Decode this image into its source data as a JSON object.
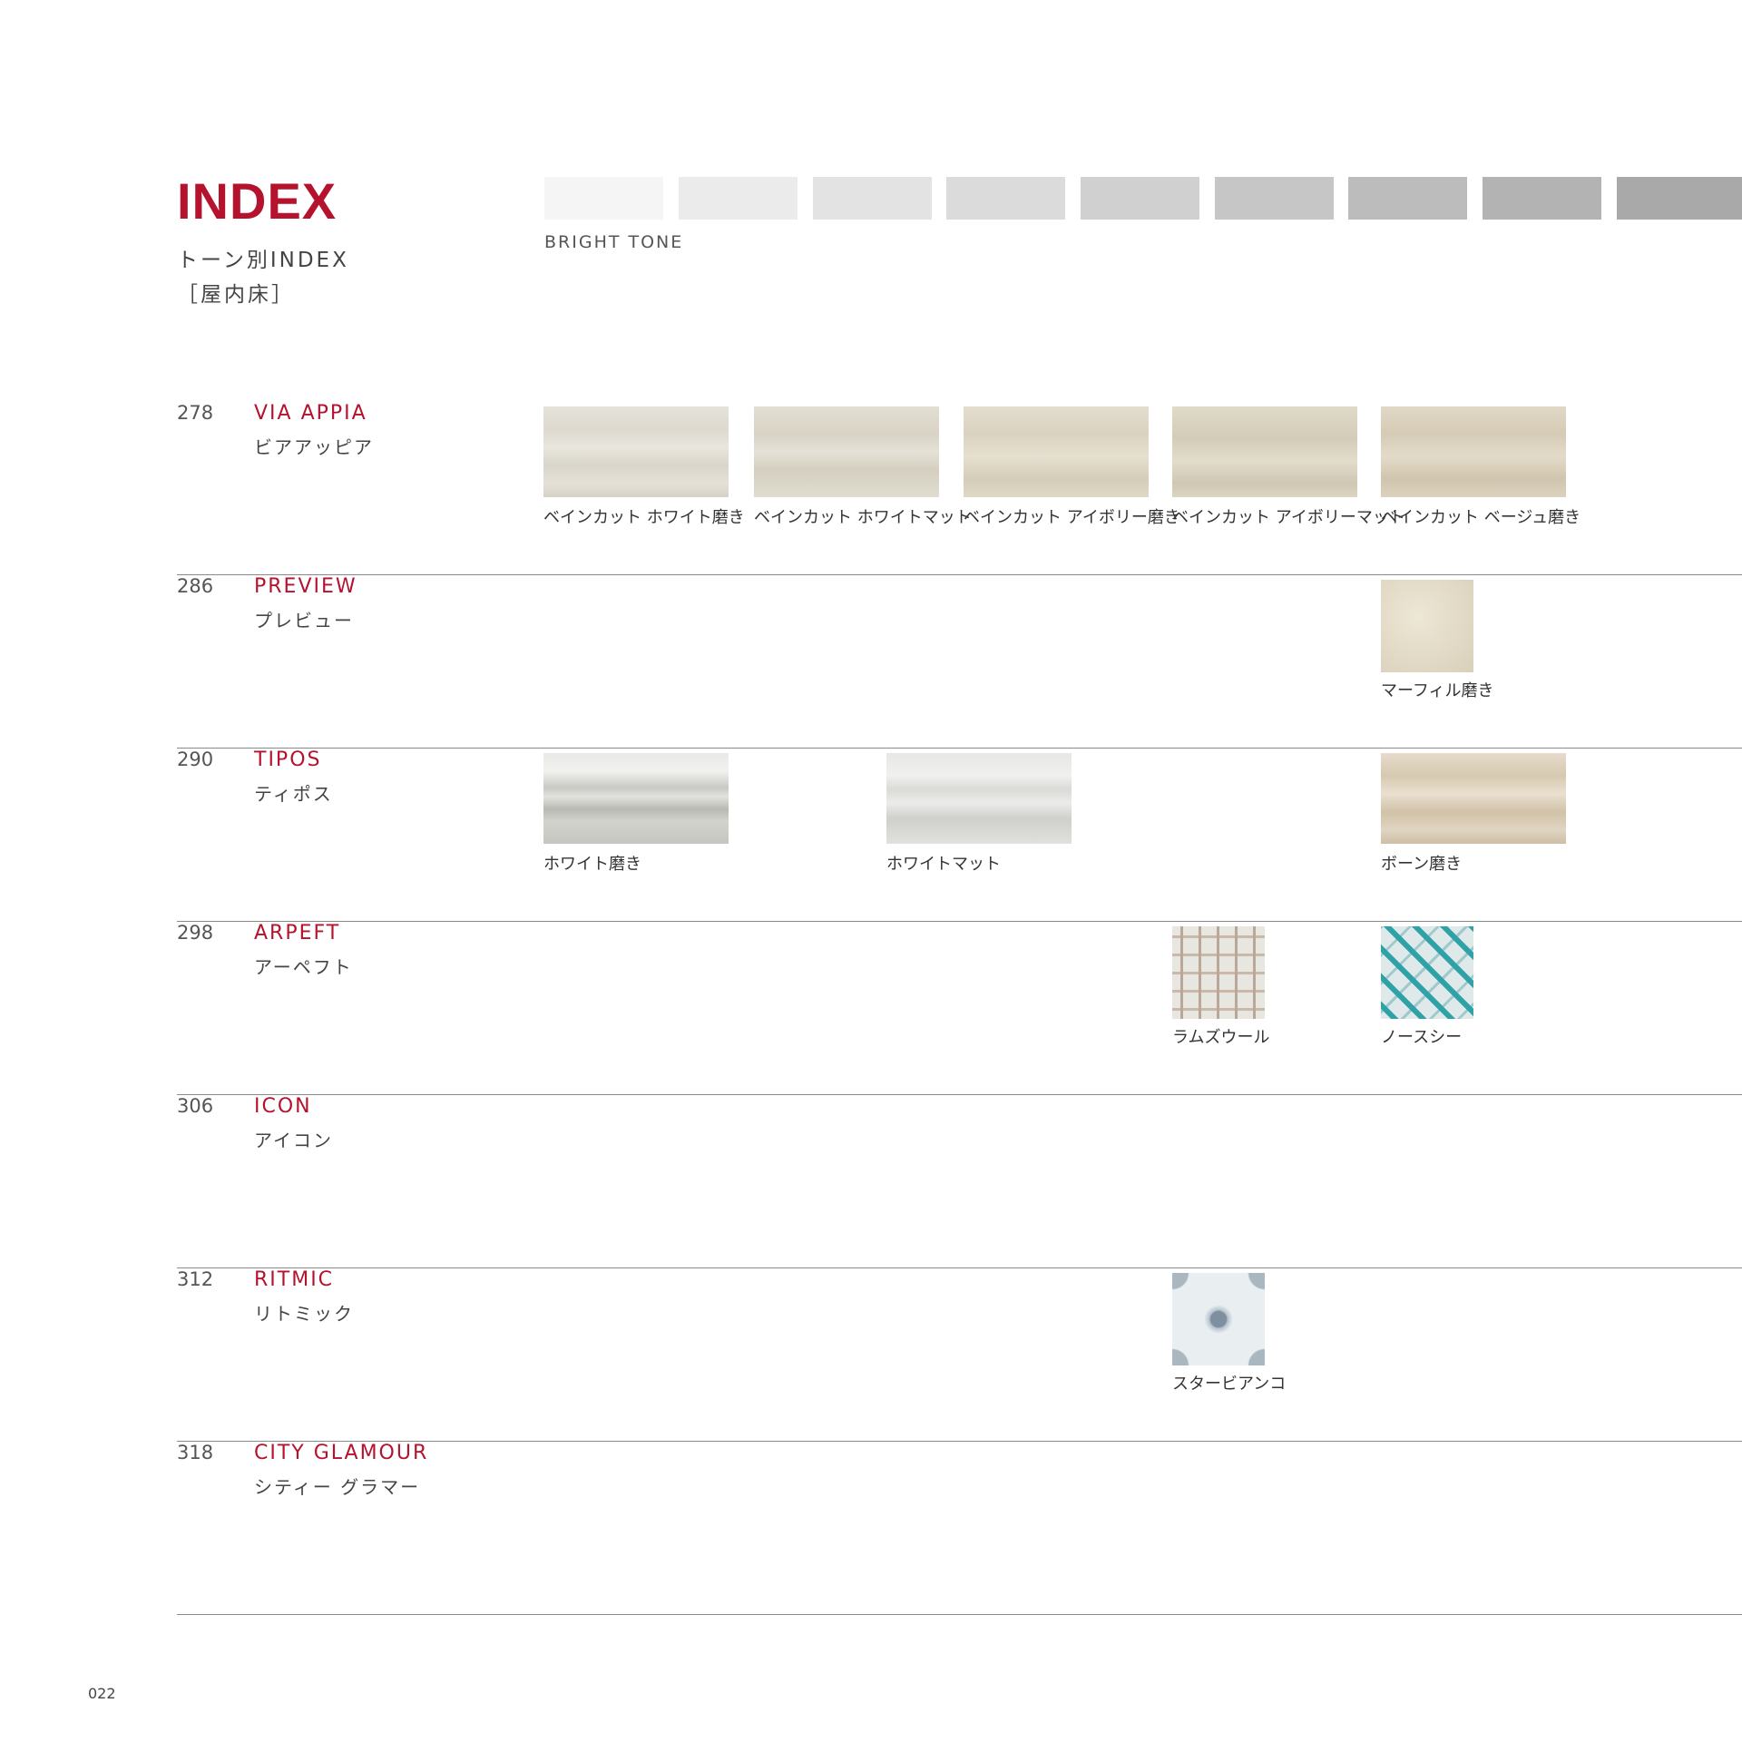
{
  "header": {
    "title": "INDEX",
    "subtitle_line1": "トーン別INDEX",
    "subtitle_line2": "［屋内床］",
    "tone_label": "BRIGHT TONE",
    "tone_swatches": [
      "#f5f5f5",
      "#ebebeb",
      "#e3e3e3",
      "#dbdbdb",
      "#d0d0d0",
      "#c6c6c6",
      "#bcbcbc",
      "#b3b3b3",
      "#a9a9a9"
    ]
  },
  "rows": [
    {
      "page": "278",
      "name_en": "VIA APPIA",
      "name_jp": "ビアアッピア",
      "tiles": [
        {
          "caption": "ベインカット ホワイト磨き"
        },
        {
          "caption": "ベインカット ホワイトマット"
        },
        {
          "caption": "ベインカット アイボリー磨き"
        },
        {
          "caption": "ベインカット アイボリーマット"
        },
        {
          "caption": "ベインカット ベージュ磨き"
        }
      ]
    },
    {
      "page": "286",
      "name_en": "PREVIEW",
      "name_jp": "プレビュー",
      "tiles": [
        {
          "caption": "マーフィル磨き"
        }
      ]
    },
    {
      "page": "290",
      "name_en": "TIPOS",
      "name_jp": "ティポス",
      "tiles": [
        {
          "caption": "ホワイト磨き"
        },
        {
          "caption": "ホワイトマット"
        },
        {
          "caption": "ボーン磨き"
        }
      ]
    },
    {
      "page": "298",
      "name_en": "ARPEFT",
      "name_jp": "アーペフト",
      "tiles": [
        {
          "caption": "ラムズウール"
        },
        {
          "caption": "ノースシー"
        }
      ]
    },
    {
      "page": "306",
      "name_en": "ICON",
      "name_jp": "アイコン",
      "tiles": []
    },
    {
      "page": "312",
      "name_en": "RITMIC",
      "name_jp": "リトミック",
      "tiles": [
        {
          "caption": "スタービアンコ"
        }
      ]
    },
    {
      "page": "318",
      "name_en": "CITY GLAMOUR",
      "name_jp": "シティー グラマー",
      "tiles": []
    }
  ],
  "footer": {
    "page_number": "022"
  },
  "colors": {
    "accent": "#b5122e",
    "rule": "#8a8a8a"
  }
}
